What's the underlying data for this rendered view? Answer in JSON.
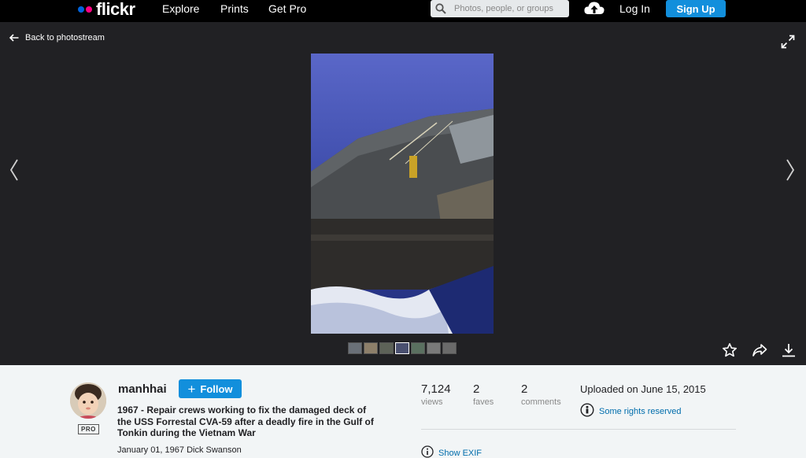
{
  "nav": {
    "logo_text": "flickr",
    "links": [
      "Explore",
      "Prints",
      "Get Pro"
    ],
    "search_placeholder": "Photos, people, or groups",
    "login_label": "Log In",
    "signup_label": "Sign Up"
  },
  "viewer": {
    "back_label": "Back to photostream",
    "thumbnail_count": 7,
    "selected_thumbnail": 4
  },
  "owner": {
    "name": "manhhai",
    "badge": "PRO",
    "follow_label": "Follow"
  },
  "photo": {
    "title": "1967 - Repair crews working to fix the damaged deck of the USS Forrestal CVA-59 after a deadly fire in the Gulf of Tonkin during the Vietnam War",
    "description": "January 01, 1967 Dick Swanson"
  },
  "stats": {
    "views": "7,124",
    "views_label": "views",
    "faves": "2",
    "faves_label": "faves",
    "comments": "2",
    "comments_label": "comments"
  },
  "meta": {
    "uploaded": "Uploaded on June 15, 2015",
    "rights": "Some rights reserved",
    "exif": "Show EXIF"
  },
  "colors": {
    "accent_blue": "#128fdc",
    "link_blue": "#006dac",
    "viewer_bg": "#212124"
  }
}
